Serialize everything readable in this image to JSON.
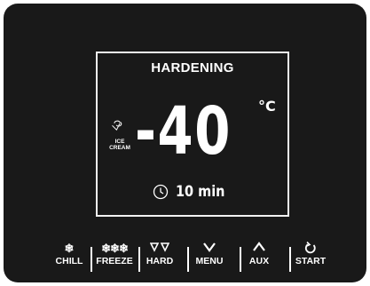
{
  "display": {
    "mode": "HARDENING",
    "product_line1": "ICE",
    "product_line2": "CREAM",
    "temperature": "-40",
    "unit": "°C",
    "timer": "10 min"
  },
  "keys": {
    "chill": "CHILL",
    "freeze": "FREEZE",
    "hard": "HARD",
    "menu": "MENU",
    "aux": "AUX",
    "start": "START"
  },
  "icons": {
    "product": "ice-cream-icon",
    "timer": "clock-icon",
    "chill": "snowflake-icon",
    "freeze": "triple-snowflake-icon",
    "hard": "double-down-arrow-icon",
    "menu": "chevron-down-icon",
    "aux": "chevron-up-icon",
    "start": "power-cycle-icon"
  },
  "colors": {
    "panel": "#191919",
    "foreground": "#ffffff"
  }
}
